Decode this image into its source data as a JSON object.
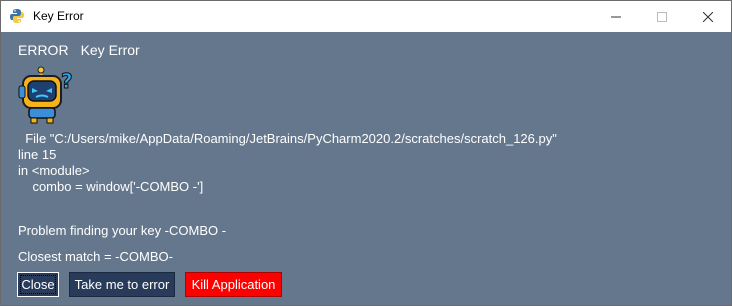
{
  "window": {
    "title": "Key Error",
    "controls": {
      "minimize": "—",
      "maximize": "☐",
      "close": "✕"
    },
    "app_icon": "python-logo-icon"
  },
  "error": {
    "label": "ERROR",
    "name": "Key Error",
    "avatar_icon": "robot-question-icon"
  },
  "traceback": {
    "file_line": "  File \"C:/Users/mike/AppData/Roaming/JetBrains/PyCharm2020.2/scratches/scratch_126.py\"",
    "line_no": "line 15",
    "location": "in <module>",
    "code": "    combo = window['-COMBO -']"
  },
  "problem": "Problem finding your key -COMBO -",
  "closest_match": "Closest match = -COMBO-",
  "buttons": {
    "close": "Close",
    "goto_error": "Take me to error",
    "kill": "Kill Application"
  },
  "colors": {
    "background": "#64778d",
    "button": "#283b5b",
    "kill_button": "#ff0000"
  }
}
